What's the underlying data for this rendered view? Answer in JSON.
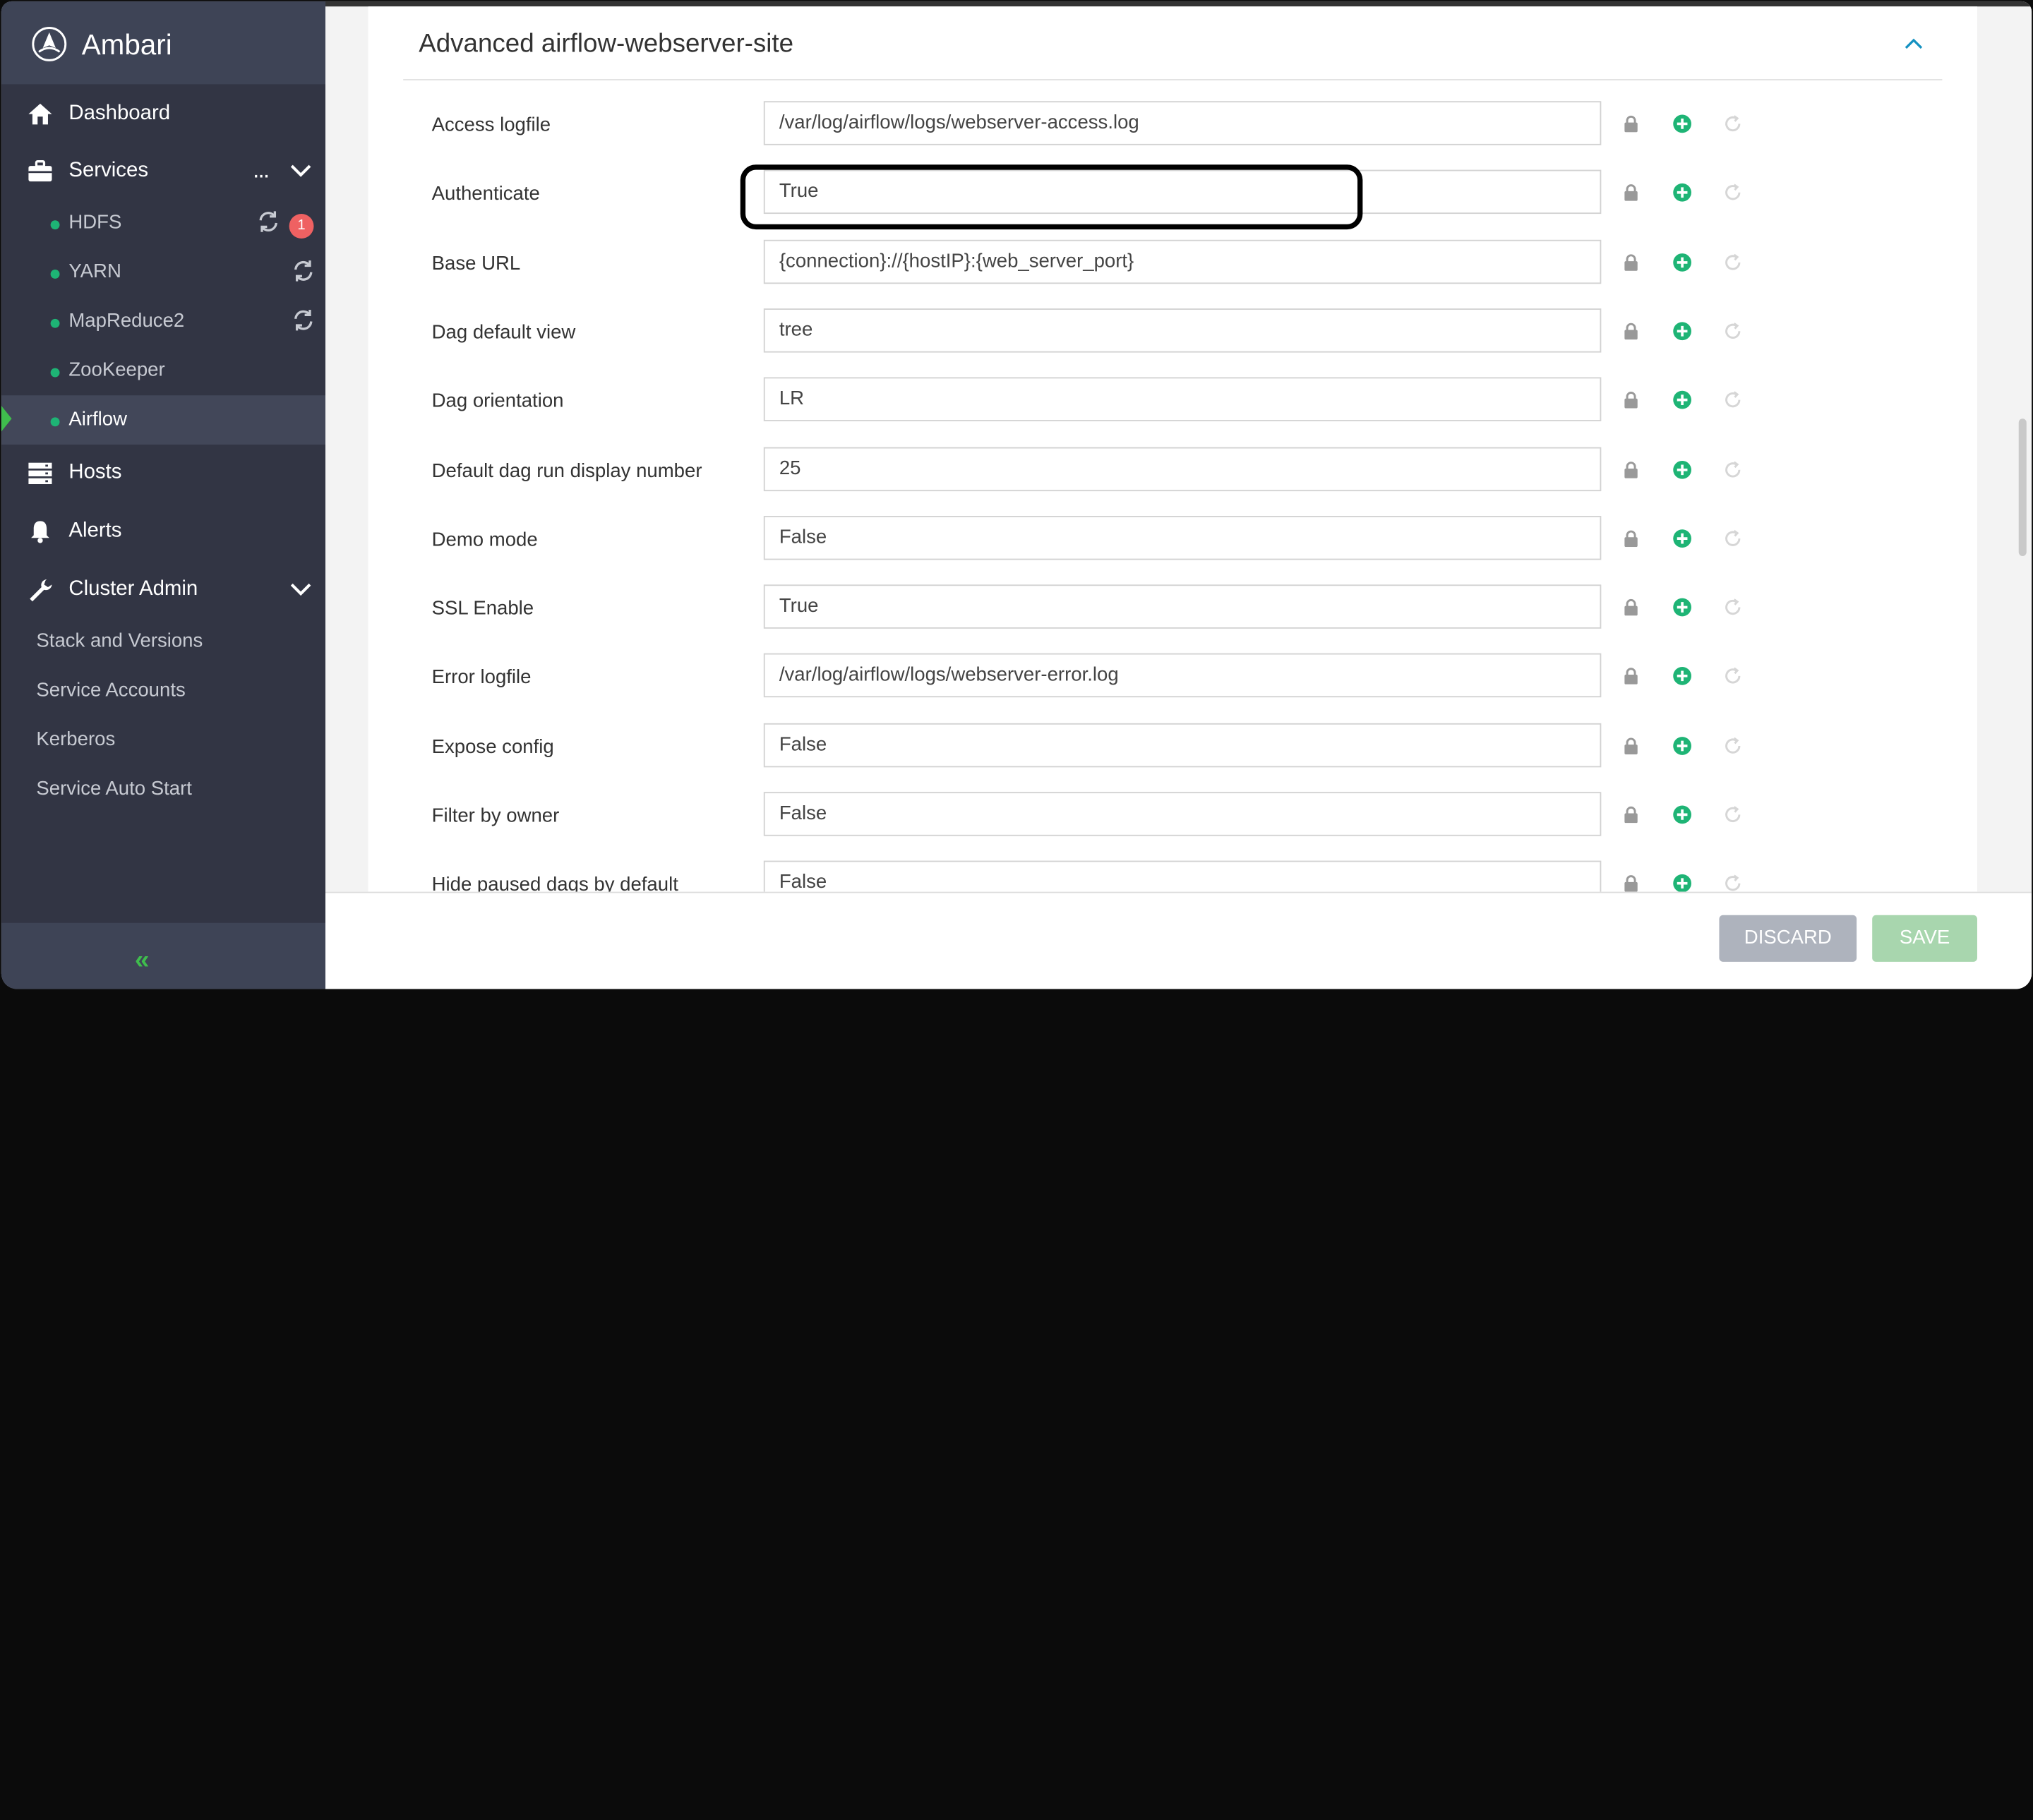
{
  "app": {
    "brand": "Ambari"
  },
  "sidebar": {
    "nav": [
      {
        "label": "Dashboard",
        "icon": "home-icon"
      },
      {
        "label": "Services",
        "icon": "briefcase-icon"
      },
      {
        "label": "Hosts",
        "icon": "server-icon"
      },
      {
        "label": "Alerts",
        "icon": "bell-icon"
      },
      {
        "label": "Cluster Admin",
        "icon": "wrench-icon"
      }
    ],
    "services_menu": "...",
    "services": [
      {
        "label": "HDFS",
        "badge": "1"
      },
      {
        "label": "YARN"
      },
      {
        "label": "MapReduce2"
      },
      {
        "label": "ZooKeeper"
      },
      {
        "label": "Airflow"
      }
    ],
    "cluster_admin_items": [
      "Stack and Versions",
      "Service Accounts",
      "Kerberos",
      "Service Auto Start"
    ],
    "collapse_glyph": "«"
  },
  "section": {
    "title": "Advanced airflow-webserver-site",
    "rows": [
      {
        "label": "Access logfile",
        "value": "/var/log/airflow/logs/webserver-access.log"
      },
      {
        "label": "Authenticate",
        "value": "True"
      },
      {
        "label": "Base URL",
        "value": "{connection}://{hostIP}:{web_server_port}"
      },
      {
        "label": "Dag default view",
        "value": "tree"
      },
      {
        "label": "Dag orientation",
        "value": "LR"
      },
      {
        "label": "Default dag run display number",
        "value": "25"
      },
      {
        "label": "Demo mode",
        "value": "False"
      },
      {
        "label": "SSL Enable",
        "value": "True"
      },
      {
        "label": "Error logfile",
        "value": "/var/log/airflow/logs/webserver-error.log"
      },
      {
        "label": "Expose config",
        "value": "False"
      },
      {
        "label": "Filter by owner",
        "value": "False"
      },
      {
        "label": "Hide paused dags by default",
        "value": "False"
      }
    ]
  },
  "footer": {
    "discard": "DISCARD",
    "save": "SAVE"
  },
  "colors": {
    "sidebar": "#323544",
    "accent_green": "#3fbd4d",
    "status_green": "#1eb475",
    "badge_red": "#ef6162"
  }
}
